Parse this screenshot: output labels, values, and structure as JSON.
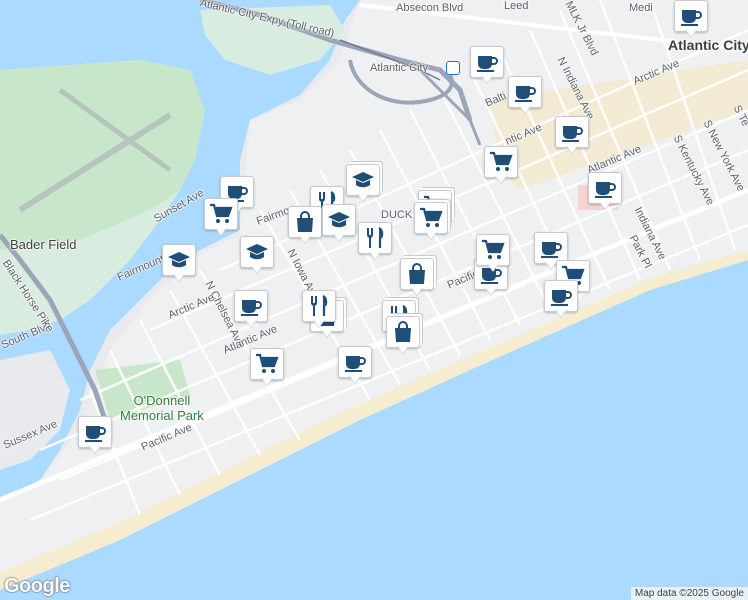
{
  "map": {
    "labels": {
      "absecon_blvd": "Absecon Blvd",
      "atlantic_city_expy": "Atlantic City Expy (Toll road)",
      "atlantic_city_station": "Atlantic City",
      "atlantic_city_town": "Atlantic City",
      "bader_field": "Bader Field",
      "black_horse_pike": "Black Horse Pike",
      "o_donnell_park": "O'Donnell\nMemorial Park",
      "mlk_jr_blvd": "MLK Jr Blvd",
      "n_indiana_ave": "N Indiana Ave",
      "arctic_ave_east": "Arctic Ave",
      "arctic_ave_mid": "Arctic Ave",
      "arctic_ave_west": "Arctic Ave",
      "atlantic_ave_east": "Atlantic Ave",
      "atlantic_ave_west": "Atlantic Ave",
      "pacific_ave_east": "Pacific Ave",
      "pacific_ave_west": "Pacific Ave",
      "sunset_ave": "Sunset Ave",
      "fairmount_ave_west": "Fairmount Ave",
      "fairmount_ave_mid": "Fairmo",
      "n_chelsea_ave": "N Chelsea Ave",
      "iowa_ave": "N Iowa Ave",
      "s_kentucky_ave": "S Kentucky Ave",
      "s_new_york_ave": "S New York Ave",
      "s_tennessee": "S Te",
      "indiana_ave": "Indiana Ave",
      "park_pl": "Park Pl",
      "south_blvd": "South Blvd",
      "sussex_ave": "Sussex Ave",
      "baltic_ave": "Balti",
      "ducks": "DUCK",
      "leeds": "Leed",
      "medi": "Medi",
      "tic_ave": "ntic Ave"
    },
    "attribution": "Map data ©2025 Google",
    "logo": "Google",
    "colors": {
      "water": "#aadaff",
      "land": "#e8eaed",
      "park": "#c8e6c9",
      "beach": "#f6ecd0",
      "highway": "#9aa6b8",
      "marker_icon": "#1f4e79"
    },
    "markers": [
      {
        "name": "cafe-marker",
        "icon": "coffee-cup"
      },
      {
        "name": "cafe-marker",
        "icon": "coffee-cup"
      },
      {
        "name": "cafe-marker",
        "icon": "coffee-cup"
      },
      {
        "name": "cafe-marker",
        "icon": "coffee-cup"
      },
      {
        "name": "grocery-marker",
        "icon": "shopping-cart"
      },
      {
        "name": "cafe-marker",
        "icon": "coffee-cup"
      },
      {
        "name": "cafe-marker",
        "icon": "coffee-cup"
      },
      {
        "name": "grocery-marker",
        "icon": "shopping-cart"
      },
      {
        "name": "restaurant-marker",
        "icon": "fork-knife"
      },
      {
        "name": "school-marker",
        "icon": "graduation-cap"
      },
      {
        "name": "shopping-marker",
        "icon": "shopping-bag"
      },
      {
        "name": "school-marker",
        "icon": "graduation-cap"
      },
      {
        "name": "restaurant-marker",
        "icon": "fork-knife"
      },
      {
        "name": "grocery-marker",
        "icon": "shopping-cart"
      },
      {
        "name": "grocery-marker",
        "icon": "shopping-cart"
      },
      {
        "name": "cafe-marker",
        "icon": "coffee-cup"
      },
      {
        "name": "grocery-marker",
        "icon": "shopping-cart"
      },
      {
        "name": "school-marker",
        "icon": "graduation-cap"
      },
      {
        "name": "school-marker",
        "icon": "graduation-cap"
      },
      {
        "name": "cafe-marker",
        "icon": "coffee-cup"
      },
      {
        "name": "shopping-marker",
        "icon": "shopping-bag"
      },
      {
        "name": "cafe-marker",
        "icon": "coffee-cup"
      },
      {
        "name": "grocery-marker",
        "icon": "shopping-cart"
      },
      {
        "name": "shopping-marker",
        "icon": "shopping-bag"
      },
      {
        "name": "restaurant-marker",
        "icon": "fork-knife"
      },
      {
        "name": "grocery-marker",
        "icon": "shopping-cart"
      },
      {
        "name": "cafe-marker",
        "icon": "coffee-cup"
      },
      {
        "name": "cafe-marker",
        "icon": "coffee-cup"
      },
      {
        "name": "restaurant-marker",
        "icon": "fork-knife"
      },
      {
        "name": "shopping-marker",
        "icon": "shopping-bag"
      },
      {
        "name": "cafe-marker",
        "icon": "coffee-cup"
      }
    ]
  }
}
